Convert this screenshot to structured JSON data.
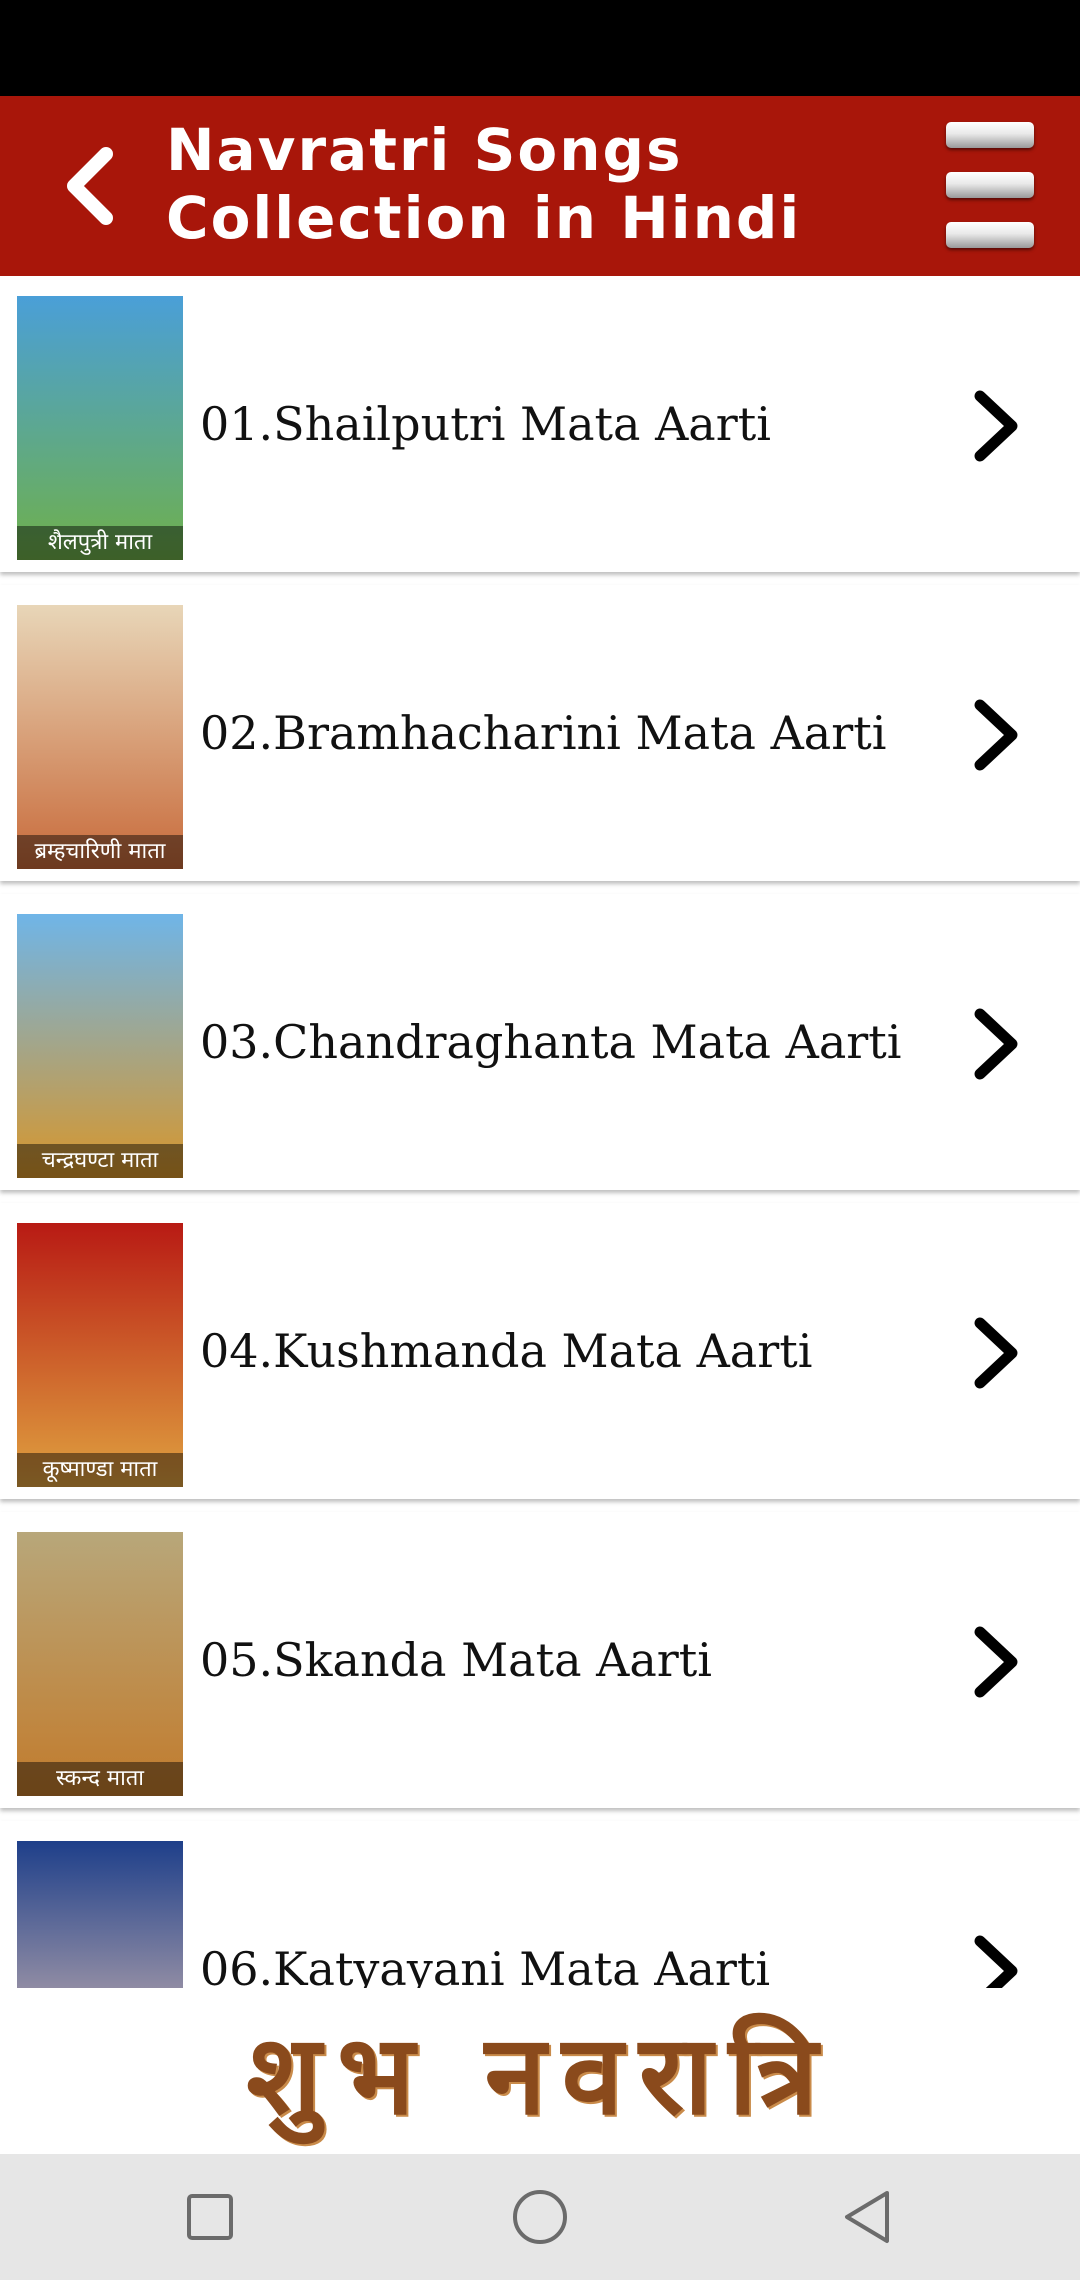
{
  "app_bar": {
    "title": "Navratri Songs Collection in Hindi",
    "back_icon": "chevron-left-icon",
    "menu_icon": "hamburger-menu-icon",
    "background_color": "#a8160a"
  },
  "list": {
    "items": [
      {
        "label": "01.Shailputri Mata Aarti",
        "thumb_caption": "शैलपुत्री माता",
        "thumb_colors": [
          "#4a9fd8",
          "#6fb04a"
        ]
      },
      {
        "label": "02.Bramhacharini Mata Aarti",
        "thumb_caption": "ब्रम्हचारिणी माता",
        "thumb_colors": [
          "#e8d6b8",
          "#c86a3a"
        ]
      },
      {
        "label": "03.Chandraghanta Mata Aarti",
        "thumb_caption": "चन्द्रघण्टा माता",
        "thumb_colors": [
          "#6fb5e8",
          "#d8962a"
        ]
      },
      {
        "label": "04.Kushmanda Mata Aarti",
        "thumb_caption": "कूष्माण्डा माता",
        "thumb_colors": [
          "#b81a14",
          "#e0a240"
        ]
      },
      {
        "label": "05.Skanda Mata Aarti",
        "thumb_caption": "स्कन्द माता",
        "thumb_colors": [
          "#b8a77a",
          "#c27b2c"
        ]
      },
      {
        "label": "06.Katyayani Mata Aarti",
        "thumb_caption": "",
        "thumb_colors": [
          "#1e3f8a",
          "#e9c8b8"
        ]
      }
    ],
    "chevron_icon": "chevron-right-icon"
  },
  "banner": {
    "text": "शुभ नवरात्रि"
  },
  "nav_bar": {
    "recent_icon": "square-recents-icon",
    "home_icon": "circle-home-icon",
    "back_icon": "triangle-back-icon"
  }
}
